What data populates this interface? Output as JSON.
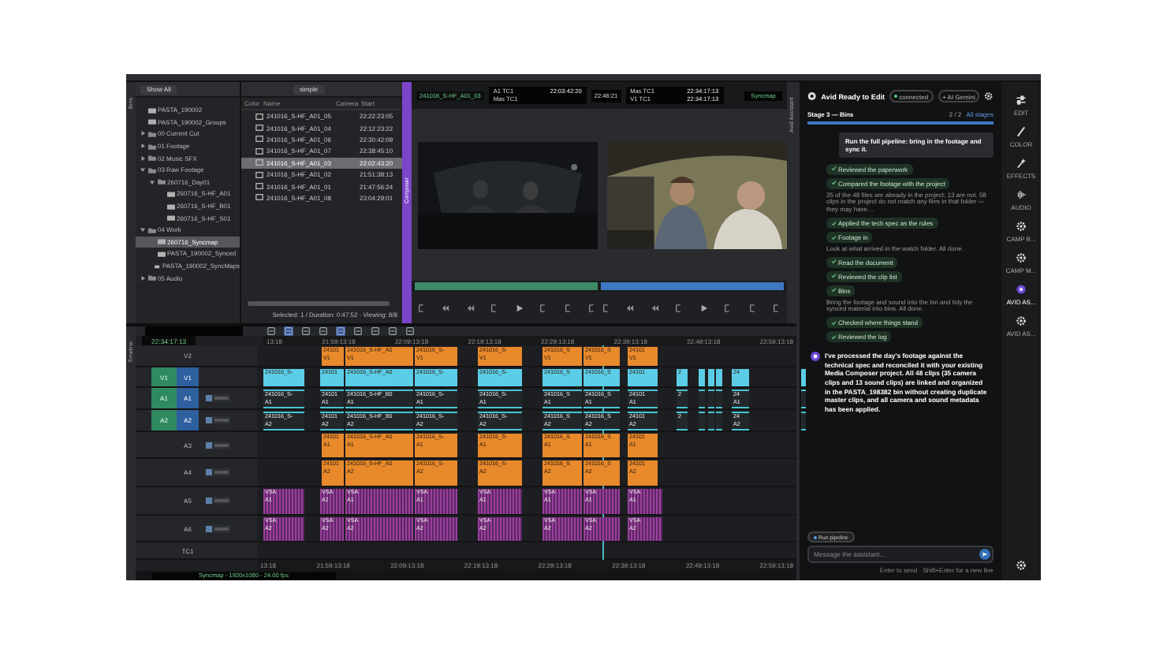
{
  "tabs": {
    "bins": "Bins",
    "composer": "Composer",
    "timeline": "Timeline",
    "assistant": "Avid Assistant"
  },
  "bins": {
    "filter": "Show All",
    "view": "simple",
    "tree": [
      {
        "kind": "bin",
        "name": "PASTA_190002",
        "selected": false
      },
      {
        "kind": "bin",
        "name": "PASTA_190002_Groups",
        "selected": false
      },
      {
        "kind": "folder",
        "name": "00 Current Cut",
        "selected": false,
        "expanded": false
      },
      {
        "kind": "folder",
        "name": "01 Footage",
        "selected": false,
        "expanded": false
      },
      {
        "kind": "folder",
        "name": "02 Music SFX",
        "selected": false,
        "expanded": false
      },
      {
        "kind": "folder",
        "name": "03 Raw Footage",
        "selected": false,
        "expanded": true,
        "children": [
          {
            "kind": "folder",
            "name": "260716_Day01",
            "selected": false,
            "expanded": true,
            "children": [
              {
                "kind": "bin",
                "name": "260716_S-HF_A01",
                "selected": false
              },
              {
                "kind": "bin",
                "name": "260716_S-HF_B01",
                "selected": false
              },
              {
                "kind": "bin",
                "name": "260716_S-HF_S01",
                "selected": false
              }
            ]
          }
        ]
      },
      {
        "kind": "folder",
        "name": "04 Work",
        "selected": false,
        "expanded": true,
        "children": [
          {
            "kind": "bin",
            "name": "260716_Syncmap",
            "selected": true
          },
          {
            "kind": "bin",
            "name": "PASTA_190002_Synced",
            "selected": false
          },
          {
            "kind": "bin",
            "name": "PASTA_190002_SyncMaps",
            "selected": false
          }
        ]
      },
      {
        "kind": "folder",
        "name": "05 Audio",
        "selected": false,
        "expanded": false
      }
    ],
    "columns": [
      "Color",
      "Name",
      "Camera",
      "Start"
    ],
    "rows": [
      {
        "name": "241016_S-HF_A01_05",
        "start": "22:22:23:05",
        "selected": false
      },
      {
        "name": "241016_S-HF_A01_04",
        "start": "22:12:23:22",
        "selected": false
      },
      {
        "name": "241016_S-HF_A01_06",
        "start": "22:30:42:09",
        "selected": false
      },
      {
        "name": "241016_S-HF_A01_07",
        "start": "22:38:45:10",
        "selected": false
      },
      {
        "name": "241016_S-HF_A01_03",
        "start": "22:02:43:20",
        "selected": true
      },
      {
        "name": "241016_S-HF_A01_02",
        "start": "21:51:38:13",
        "selected": false
      },
      {
        "name": "241016_S-HF_A01_01",
        "start": "21:47:56:24",
        "selected": false
      },
      {
        "name": "241016_S-HF_A01_08",
        "start": "23:04:29:01",
        "selected": false
      }
    ],
    "status": "Selected: 1 / Duration: 0:47:52 · Viewing: 8/8"
  },
  "composer": {
    "source_clip": "241016_S-HF_A01_03",
    "source_tc": [
      {
        "label": "A1 TC1",
        "value": "22:03:42:20"
      },
      {
        "label": "Mas TC1"
      }
    ],
    "center_tc": "22:46:21",
    "record_tc": [
      {
        "label": "Mas TC1",
        "value": "22:34:17:13"
      },
      {
        "label": "V1 TC1",
        "value": "22:34:17:13"
      }
    ],
    "sequence": "Syncmap"
  },
  "timeline": {
    "timecode": "22:34:17:13",
    "ruler": [
      "13:18",
      "21:59:13:18",
      "22:09:13:18",
      "22:19:13:18",
      "22:29:13:18",
      "22:39:13:18",
      "22:49:13:18",
      "22:59:13:18"
    ],
    "ruler_bottom": [
      "13:18",
      "21:59:13:18",
      "22:09:13:18",
      "22:19:13:18",
      "22:29:13:18",
      "22:39:13:18",
      "22:49:13:18",
      "22:59:13:18"
    ],
    "tracks": [
      {
        "name": "V2",
        "selected": false,
        "kind": "filled",
        "color": "#e8892c",
        "clips": [
          {
            "kind": "labeled",
            "label": "24101",
            "sub": "V1"
          },
          {
            "kind": "labeled",
            "label": "241016_S-HF_A0",
            "sub": "V1"
          },
          {
            "kind": "labeled",
            "label": "241016_S-",
            "sub": "V1"
          },
          {
            "kind": "labeled",
            "label": "241016_S-",
            "sub": "V1"
          },
          {
            "kind": "labeled",
            "label": "241016_S",
            "sub": "V1"
          },
          {
            "kind": "labeled",
            "label": "241016_S",
            "sub": "V1"
          },
          {
            "kind": "labeled",
            "label": "24101",
            "sub": "V1"
          }
        ]
      },
      {
        "name": "V1",
        "source": "V1",
        "selected": true,
        "kind": "filled",
        "color": "#5ccde6",
        "clips": [
          {
            "kind": "labeled",
            "label": "241016_S-"
          },
          {
            "kind": "labeled",
            "label": "24101"
          },
          {
            "kind": "labeled",
            "label": "241016_S-HF_A0"
          },
          {
            "kind": "labeled",
            "label": "241016_S-"
          },
          {
            "kind": "labeled",
            "label": "241016_S-"
          },
          {
            "kind": "labeled",
            "label": "241016_S"
          },
          {
            "kind": "labeled",
            "label": "241016_S"
          },
          {
            "kind": "labeled",
            "label": "24101"
          },
          {
            "kind": "labeled",
            "label": "2"
          },
          {
            "kind": "narrow"
          },
          {
            "kind": "narrow"
          },
          {
            "kind": "narrow"
          },
          {
            "kind": "labeled",
            "label": "24"
          },
          {
            "kind": "narrow"
          }
        ]
      },
      {
        "name": "A1",
        "source": "A1",
        "selected": true,
        "kind": "outline",
        "color": "#46c6d6",
        "clips": [
          {
            "kind": "labeled",
            "label": "241016_S-",
            "sub": "A1"
          },
          {
            "kind": "labeled",
            "label": "24101",
            "sub": "A1"
          },
          {
            "kind": "labeled",
            "label": "241016_S-HF_B0",
            "sub": "A1"
          },
          {
            "kind": "labeled",
            "label": "241016_S-",
            "sub": "A1"
          },
          {
            "kind": "labeled",
            "label": "241016_S-",
            "sub": "A1"
          },
          {
            "kind": "labeled",
            "label": "241016_S",
            "sub": "A1"
          },
          {
            "kind": "labeled",
            "label": "241016_S",
            "sub": "A1"
          },
          {
            "kind": "labeled",
            "label": "24101",
            "sub": "A1"
          },
          {
            "kind": "labeled",
            "label": "2"
          },
          {
            "kind": "narrow"
          },
          {
            "kind": "narrow"
          },
          {
            "kind": "narrow"
          },
          {
            "kind": "labeled",
            "label": "24",
            "sub": "A1"
          },
          {
            "kind": "narrow"
          }
        ]
      },
      {
        "name": "A2",
        "source": "A2",
        "selected": true,
        "kind": "outline",
        "color": "#46c6d6",
        "clips": [
          {
            "kind": "labeled",
            "label": "241016_S-",
            "sub": "A2"
          },
          {
            "kind": "labeled",
            "label": "24101",
            "sub": "A2"
          },
          {
            "kind": "labeled",
            "label": "241016_S-HF_B0",
            "sub": "A2"
          },
          {
            "kind": "labeled",
            "label": "241016_S-",
            "sub": "A2"
          },
          {
            "kind": "labeled",
            "label": "241016_S-",
            "sub": "A2"
          },
          {
            "kind": "labeled",
            "label": "241016_S",
            "sub": "A2"
          },
          {
            "kind": "labeled",
            "label": "241016_S",
            "sub": "A2"
          },
          {
            "kind": "labeled",
            "label": "24101",
            "sub": "A2"
          },
          {
            "kind": "labeled",
            "label": "2"
          },
          {
            "kind": "narrow"
          },
          {
            "kind": "narrow"
          },
          {
            "kind": "narrow"
          },
          {
            "kind": "labeled",
            "label": "24",
            "sub": "A2"
          },
          {
            "kind": "narrow"
          }
        ]
      },
      {
        "name": "A3",
        "selected": false,
        "kind": "filled",
        "color": "#e8892c",
        "clips": [
          {
            "kind": "labeled",
            "label": "24101",
            "sub": "A1"
          },
          {
            "kind": "labeled",
            "label": "241016_S-HF_A0",
            "sub": "A1"
          },
          {
            "kind": "labeled",
            "label": "241016_S-",
            "sub": "A1"
          },
          {
            "kind": "labeled",
            "label": "241016_S-",
            "sub": "A1"
          },
          {
            "kind": "labeled",
            "label": "241016_S",
            "sub": "A1"
          },
          {
            "kind": "labeled",
            "label": "241016_S",
            "sub": "A1"
          },
          {
            "kind": "labeled",
            "label": "24101",
            "sub": "A1"
          }
        ]
      },
      {
        "name": "A4",
        "selected": false,
        "kind": "filled",
        "color": "#e8892c",
        "clips": [
          {
            "kind": "labeled",
            "label": "24101",
            "sub": "A2"
          },
          {
            "kind": "labeled",
            "label": "241016_S-HF_A0",
            "sub": "A2"
          },
          {
            "kind": "labeled",
            "label": "241016_S-",
            "sub": "A2"
          },
          {
            "kind": "labeled",
            "label": "241016_S-",
            "sub": "A2"
          },
          {
            "kind": "labeled",
            "label": "241016_S",
            "sub": "A2"
          },
          {
            "kind": "labeled",
            "label": "241016_S",
            "sub": "A2"
          },
          {
            "kind": "labeled",
            "label": "24101",
            "sub": "A2"
          }
        ]
      },
      {
        "name": "A5",
        "selected": false,
        "kind": "wave",
        "color": "#9b3f9e",
        "clips": [
          {
            "kind": "labeled",
            "label": "VSA",
            "sub": "A1"
          },
          {
            "kind": "labeled",
            "label": "VSA",
            "sub": "A1"
          },
          {
            "kind": "labeled",
            "label": "VSA",
            "sub": "A1"
          },
          {
            "kind": "labeled",
            "label": "VSA",
            "sub": "A1"
          },
          {
            "kind": "labeled",
            "label": "VSA",
            "sub": "A1"
          },
          {
            "kind": "labeled",
            "label": "VSA",
            "sub": "A1"
          },
          {
            "kind": "labeled",
            "label": "VSA",
            "sub": "A1"
          },
          {
            "kind": "labeled",
            "label": "VSA",
            "sub": "A1"
          }
        ]
      },
      {
        "name": "A6",
        "selected": false,
        "kind": "wave",
        "color": "#9b3f9e",
        "clips": [
          {
            "kind": "labeled",
            "label": "VSA",
            "sub": "A2"
          },
          {
            "kind": "labeled",
            "label": "VSA",
            "sub": "A2"
          },
          {
            "kind": "labeled",
            "label": "VSA",
            "sub": "A2"
          },
          {
            "kind": "labeled",
            "label": "VSA",
            "sub": "A2"
          },
          {
            "kind": "labeled",
            "label": "VSA",
            "sub": "A2"
          },
          {
            "kind": "labeled",
            "label": "VSA",
            "sub": "A2"
          },
          {
            "kind": "labeled",
            "label": "VSA",
            "sub": "A2"
          },
          {
            "kind": "labeled",
            "label": "VSA",
            "sub": "A2"
          }
        ]
      },
      {
        "name": "TC1",
        "selected": false
      }
    ],
    "status": "Syncmap - 1920x1080 - 24.00 fps"
  },
  "assistant": {
    "title": "Avid Ready to Edit",
    "status": "connected",
    "model": "+ AI Gemini",
    "stage": "Stage 3 — Bins",
    "stage_count": "2 / 2",
    "all_stages": "All stages",
    "level": 1,
    "prompt": "Run the full pipeline: bring in the footage and sync it.",
    "steps": [
      {
        "label": "Reviewed the paperwork",
        "done": true
      },
      {
        "label": "Compared the footage with the project",
        "done": true,
        "note": "35 of the 48 files are already in the project; 13 are not. 58 clips in the project do not match any files in that folder — they may have…"
      },
      {
        "label": "Applied the tech spec as the rules",
        "done": true
      },
      {
        "label": "Footage in",
        "done": true,
        "note": "Look at what arrived in the watch folder. All done."
      },
      {
        "label": "Read the document",
        "done": true
      },
      {
        "label": "Reviewed the clip list",
        "done": true
      },
      {
        "label": "Bins",
        "done": true,
        "note": "Bring the footage and sound into the bin and tidy the synced material into bins. All done."
      },
      {
        "label": "Checked where things stand",
        "done": true
      },
      {
        "label": "Reviewed the log",
        "done": true
      }
    ],
    "reply": "I've processed the day's footage against the technical spec and reconciled it with your existing Media Composer project. All 48 clips (35 camera clips and 13 sound clips) are linked and organized in the PASTA_198382 bin without creating duplicate master clips, and all camera and sound metadata has been applied.",
    "chip": "Run pipeline",
    "placeholder": "Message the assistant...",
    "hint": "Enter to send · Shift+Enter for a new line"
  },
  "rail": [
    {
      "kind": "sliders",
      "label": "EDIT",
      "selected": false
    },
    {
      "kind": "brush",
      "label": "COLOR",
      "selected": false
    },
    {
      "kind": "wand",
      "label": "EFFECTS",
      "selected": false
    },
    {
      "kind": "wave",
      "label": "AUDIO",
      "selected": false
    },
    {
      "kind": "gear",
      "label": "CAMP B...",
      "selected": false
    },
    {
      "kind": "gear",
      "label": "CAMP M...",
      "selected": false
    },
    {
      "kind": "dot",
      "label": "AVID AS...",
      "selected": true
    },
    {
      "kind": "gear",
      "label": "AVID AS...",
      "selected": false
    }
  ]
}
